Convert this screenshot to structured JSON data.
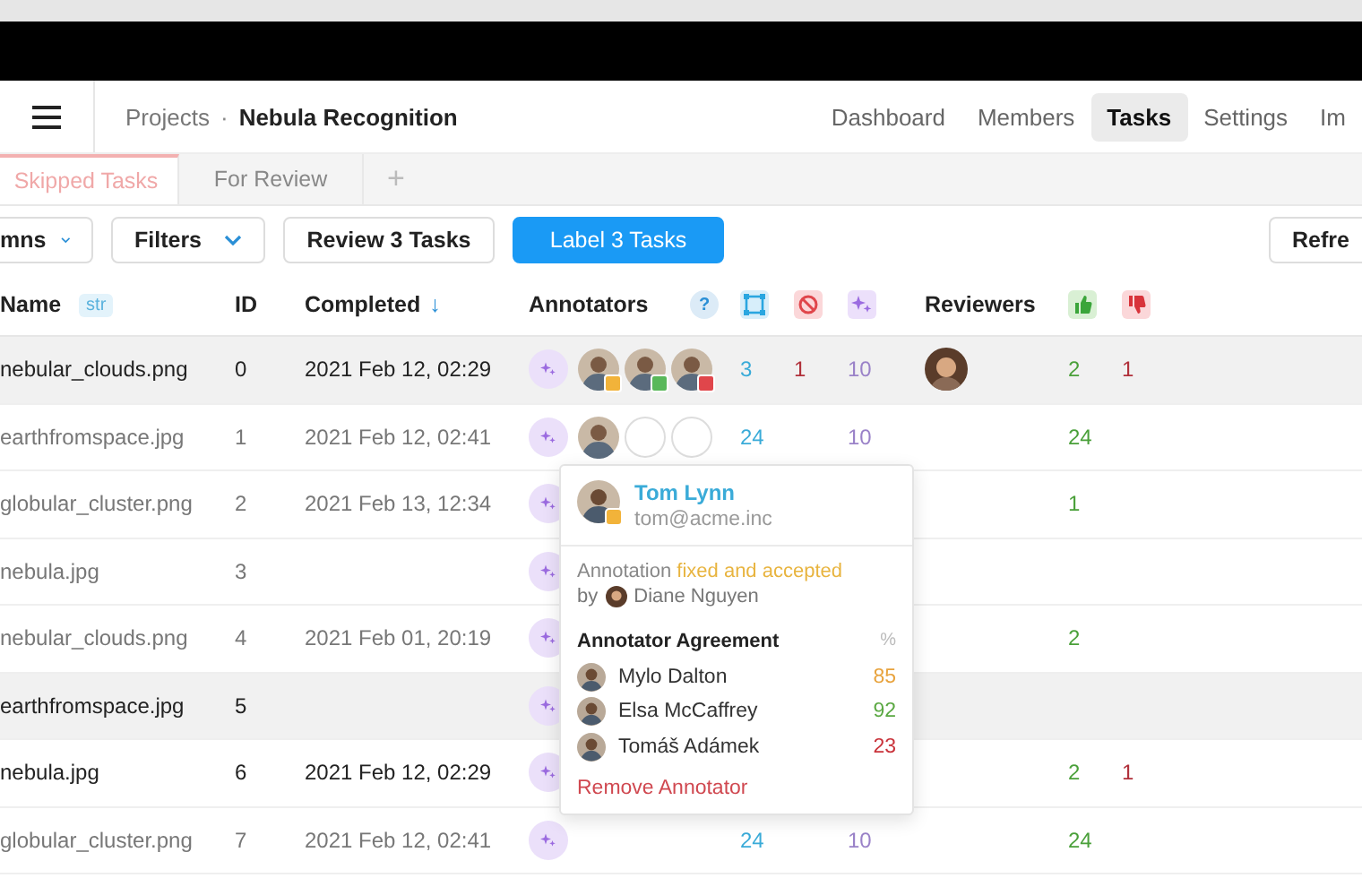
{
  "breadcrumb": {
    "parent": "Projects",
    "separator": "·",
    "current": "Nebula Recognition"
  },
  "nav": [
    {
      "label": "Dashboard",
      "selected": false
    },
    {
      "label": "Members",
      "selected": false
    },
    {
      "label": "Tasks",
      "selected": true
    },
    {
      "label": "Settings",
      "selected": false
    },
    {
      "label": "Im",
      "selected": false
    }
  ],
  "tabs": [
    {
      "label": "Skipped Tasks",
      "selected": true
    },
    {
      "label": "For Review",
      "selected": false
    }
  ],
  "add_tab": "+",
  "toolbar": {
    "columns": "mns",
    "filters": "Filters",
    "review": "Review 3 Tasks",
    "label": "Label 3 Tasks",
    "refresh": "Refre"
  },
  "table": {
    "columns": {
      "name": "Name",
      "name_type": "str",
      "id": "ID",
      "completed": "Completed",
      "sort": "↓",
      "annotators": "Annotators",
      "help": "?",
      "reviewers": "Reviewers"
    },
    "rows": [
      {
        "name": "nebular_clouds.png",
        "id": "0",
        "completed": "2021 Feb 12, 02:29",
        "highlighted": true,
        "bold": true,
        "annotators": [
          {
            "kind": "photo",
            "color": "#f2b33a"
          },
          {
            "kind": "photo",
            "color": "#59b85a"
          },
          {
            "kind": "photo",
            "color": "#e0464b"
          }
        ],
        "annotations": "3",
        "cancelled": "1",
        "predictions": "10",
        "reviewer": true,
        "accepted": "2",
        "rejected": "1"
      },
      {
        "name": "earthfromspace.jpg",
        "id": "1",
        "completed": "2021 Feb 12, 02:41",
        "highlighted": false,
        "bold": false,
        "annotators": [
          {
            "kind": "photo"
          },
          {
            "kind": "empty"
          },
          {
            "kind": "empty"
          }
        ],
        "annotations": "24",
        "predictions": "10",
        "reviewer": false,
        "accepted": "24"
      },
      {
        "name": "globular_cluster.png",
        "id": "2",
        "completed": "2021 Feb 13, 12:34",
        "highlighted": false,
        "bold": false,
        "annotators": [],
        "reviewer": false,
        "accepted": "1"
      },
      {
        "name": "nebula.jpg",
        "id": "3",
        "highlighted": false,
        "bold": false,
        "annotators": [],
        "reviewer": false
      },
      {
        "name": "nebular_clouds.png",
        "id": "4",
        "completed": "2021 Feb 01, 20:19",
        "highlighted": false,
        "bold": false,
        "annotators": [],
        "reviewer": false,
        "accepted": "2"
      },
      {
        "name": "earthfromspace.jpg",
        "id": "5",
        "highlighted": true,
        "bold": true,
        "annotators": [],
        "reviewer": false
      },
      {
        "name": "nebula.jpg",
        "id": "6",
        "completed": "2021 Feb 12, 02:29",
        "highlighted": false,
        "bold": true,
        "annotators": [],
        "reviewer": false,
        "accepted": "2",
        "rejected": "1"
      },
      {
        "name": "globular_cluster.png",
        "id": "7",
        "completed": "2021 Feb 12, 02:41",
        "highlighted": false,
        "bold": false,
        "annotators": [],
        "annotations": "24",
        "predictions": "10",
        "reviewer": false,
        "accepted": "24"
      }
    ]
  },
  "popover": {
    "name": "Tom Lynn",
    "email": "tom@acme.inc",
    "status_prefix": "Annotation",
    "status": "fixed and accepted",
    "by": "by",
    "reviewer": "Diane Nguyen",
    "agreement_title": "Annotator Agreement",
    "percent": "%",
    "agreement": [
      {
        "name": "Mylo Dalton",
        "score": "85",
        "color": "#e8a33d"
      },
      {
        "name": "Elsa McCaffrey",
        "score": "92",
        "color": "#5aa842"
      },
      {
        "name": "Tomáš Adámek",
        "score": "23",
        "color": "#c9323a"
      }
    ],
    "remove": "Remove Annotator"
  }
}
